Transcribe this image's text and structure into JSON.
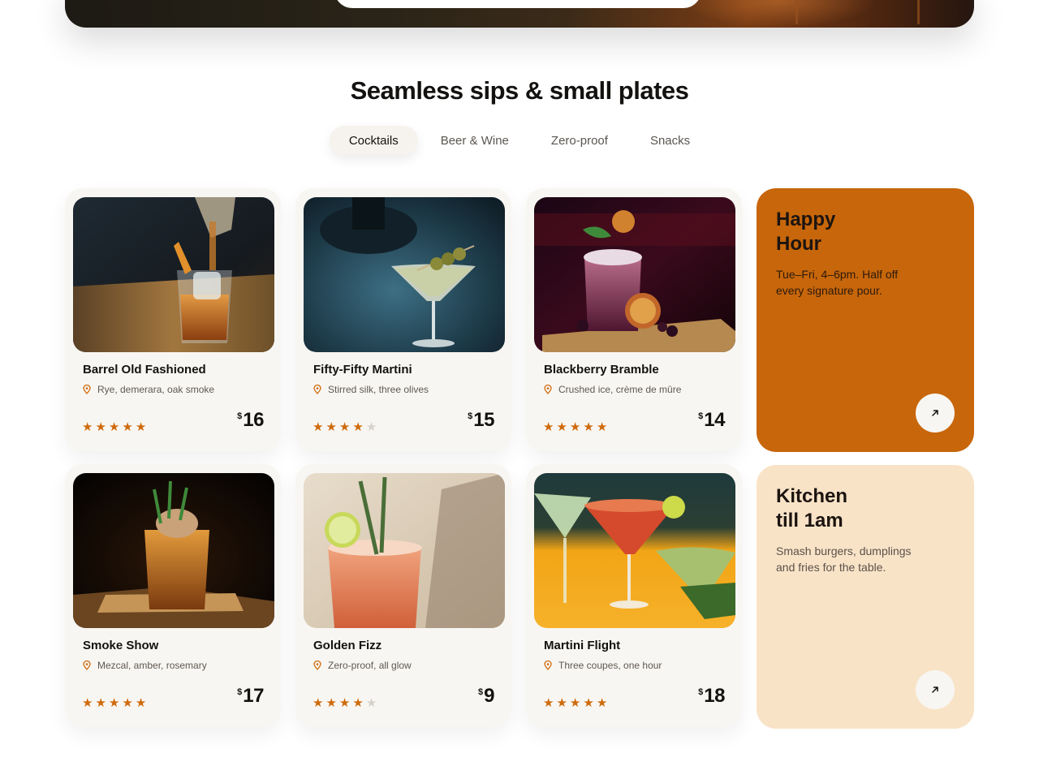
{
  "section": {
    "title": "Seamless sips & small plates"
  },
  "tabs": [
    {
      "label": "Cocktails",
      "active": true
    },
    {
      "label": "Beer & Wine",
      "active": false
    },
    {
      "label": "Zero-proof",
      "active": false
    },
    {
      "label": "Snacks",
      "active": false
    }
  ],
  "items": [
    {
      "name": "Barrel Old Fashioned",
      "desc": "Rye, demerara, oak smoke",
      "rating": 5,
      "currency": "$",
      "price": "16"
    },
    {
      "name": "Fifty-Fifty Martini",
      "desc": "Stirred silk, three olives",
      "rating": 4,
      "currency": "$",
      "price": "15"
    },
    {
      "name": "Blackberry Bramble",
      "desc": "Crushed ice, crème de mûre",
      "rating": 5,
      "currency": "$",
      "price": "14"
    },
    {
      "name": "Smoke Show",
      "desc": "Mezcal, amber, rosemary",
      "rating": 5,
      "currency": "$",
      "price": "17"
    },
    {
      "name": "Golden Fizz",
      "desc": "Zero-proof, all glow",
      "rating": 4,
      "currency": "$",
      "price": "9"
    },
    {
      "name": "Martini Flight",
      "desc": "Three coupes, one hour",
      "rating": 5,
      "currency": "$",
      "price": "18"
    }
  ],
  "promos": {
    "happy_hour": {
      "title": "Happy Hour",
      "text": "Tue–Fri, 4–6pm. Half off every signature pour.",
      "bg": "#c7660a"
    },
    "kitchen": {
      "title": "Kitchen till 1am",
      "text": "Smash burgers, dumplings and fries for the table.",
      "bg": "#f9e3c7"
    }
  },
  "colors": {
    "accent": "#cf6a0d",
    "star_off": "#d5d1cb",
    "card_bg": "#f8f6f2"
  },
  "icons": {
    "location": "map-pin-icon",
    "arrow": "arrow-up-right-icon",
    "rating": "star-icon"
  }
}
